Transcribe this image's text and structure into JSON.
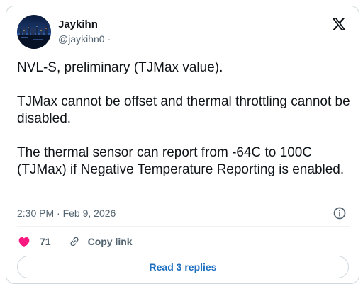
{
  "author": {
    "name": "Jaykihn",
    "handle": "@jaykihn0",
    "handle_separator": "·"
  },
  "tweet": {
    "paragraphs": [
      "NVL-S, preliminary (TJMax value).",
      "TJMax cannot be offset and thermal throttling cannot be disabled.",
      "The thermal sensor can report from -64C to 100C (TJMax) if Negative Temperature Reporting is enabled."
    ],
    "timestamp": "2:30 PM · Feb 9, 2026"
  },
  "actions": {
    "like_count": "71",
    "copy_link_label": "Copy link",
    "read_replies_label": "Read 3 replies"
  },
  "colors": {
    "text": "#0f1419",
    "secondary": "#536471",
    "border": "#cfd9de",
    "like": "#f91880",
    "link": "#1d6fbf"
  },
  "icons": {
    "brand": "x-logo-icon",
    "info": "info-icon",
    "like": "heart-icon",
    "copy": "link-icon"
  }
}
